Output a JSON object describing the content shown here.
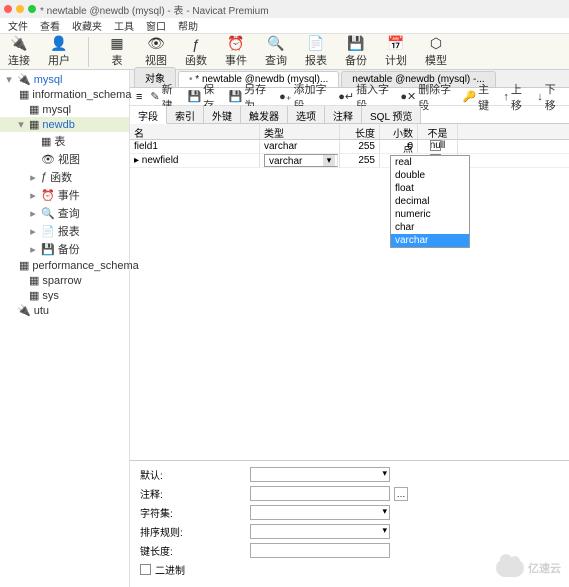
{
  "title": "* newtable @newdb (mysql) - 表 - Navicat Premium",
  "menu": [
    "文件",
    "查看",
    "收藏夹",
    "工具",
    "窗口",
    "帮助"
  ],
  "toolbar": [
    {
      "icon": "🔌",
      "label": "连接"
    },
    {
      "icon": "👤",
      "label": "用户"
    },
    {
      "sep": true
    },
    {
      "icon": "▦",
      "label": "表"
    },
    {
      "icon": "👁",
      "label": "视图"
    },
    {
      "icon": "ƒ",
      "label": "函数"
    },
    {
      "icon": "⏰",
      "label": "事件"
    },
    {
      "icon": "🔍",
      "label": "查询"
    },
    {
      "icon": "📄",
      "label": "报表"
    },
    {
      "icon": "💾",
      "label": "备份"
    },
    {
      "icon": "📅",
      "label": "计划"
    },
    {
      "icon": "⬡",
      "label": "模型"
    }
  ],
  "tree": [
    {
      "exp": "▾",
      "icon": "🔌",
      "label": "mysql",
      "cls": "bl",
      "ind": 0
    },
    {
      "exp": "",
      "icon": "▦",
      "label": "information_schema",
      "ind": 1
    },
    {
      "exp": "",
      "icon": "▦",
      "label": "mysql",
      "ind": 1
    },
    {
      "exp": "▾",
      "icon": "▦",
      "label": "newdb",
      "sel": true,
      "ind": 1,
      "cls": "bl"
    },
    {
      "exp": "",
      "icon": "▦",
      "label": "表",
      "ind": 2
    },
    {
      "exp": "",
      "icon": "👁",
      "label": "视图",
      "ind": 2
    },
    {
      "exp": "▸",
      "icon": "ƒ",
      "label": "函数",
      "ind": 2
    },
    {
      "exp": "▸",
      "icon": "⏰",
      "label": "事件",
      "ind": 2
    },
    {
      "exp": "▸",
      "icon": "🔍",
      "label": "查询",
      "ind": 2
    },
    {
      "exp": "▸",
      "icon": "📄",
      "label": "报表",
      "ind": 2
    },
    {
      "exp": "▸",
      "icon": "💾",
      "label": "备份",
      "ind": 2
    },
    {
      "exp": "",
      "icon": "▦",
      "label": "performance_schema",
      "ind": 1
    },
    {
      "exp": "",
      "icon": "▦",
      "label": "sparrow",
      "ind": 1
    },
    {
      "exp": "",
      "icon": "▦",
      "label": "sys",
      "ind": 1
    },
    {
      "exp": "",
      "icon": "🔌",
      "label": "utu",
      "ind": 0
    }
  ],
  "tabs": {
    "obj": "对象",
    "t1": "* newtable @newdb (mysql)...",
    "t2": "newtable @newdb (mysql) -..."
  },
  "actions": {
    "new": "新建",
    "save": "保存",
    "saveas": "另存为",
    "addfield": "添加字段",
    "insfield": "插入字段",
    "delfield": "删除字段",
    "pkey": "主键",
    "up": "上移",
    "down": "下移"
  },
  "subtabs": [
    "字段",
    "索引",
    "外键",
    "触发器",
    "选项",
    "注释",
    "SQL 预览"
  ],
  "columns": {
    "name": "名",
    "type": "类型",
    "len": "长度",
    "dec": "小数点",
    "null": "不是 null"
  },
  "rows": [
    {
      "name": "field1",
      "type": "varchar",
      "len": "255",
      "dec": "0"
    },
    {
      "name": "newfield",
      "type": "varchar",
      "len": "255",
      "dec": "",
      "editing": true,
      "marker": "▸"
    }
  ],
  "dropdown_options": [
    "real",
    "double",
    "float",
    "decimal",
    "numeric",
    "char",
    "varchar"
  ],
  "dropdown_selected": "varchar",
  "form": {
    "default": "默认:",
    "comment": "注释:",
    "charset": "字符集:",
    "collation": "排序规则:",
    "keylen": "键长度:",
    "binary": "二进制"
  },
  "watermark": "亿速云"
}
